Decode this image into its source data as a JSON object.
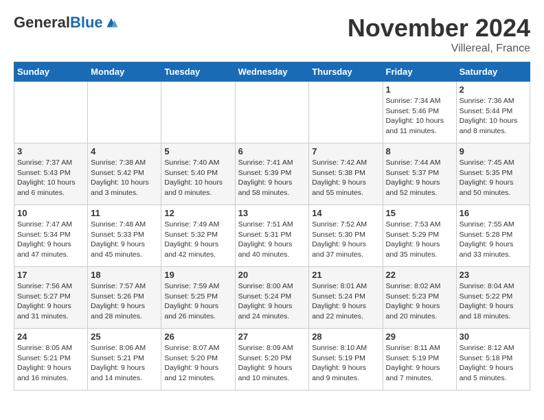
{
  "header": {
    "logo": {
      "general": "General",
      "blue": "Blue"
    },
    "title": "November 2024",
    "subtitle": "Villereal, France"
  },
  "days_of_week": [
    "Sunday",
    "Monday",
    "Tuesday",
    "Wednesday",
    "Thursday",
    "Friday",
    "Saturday"
  ],
  "weeks": [
    [
      {
        "day": null,
        "info": null
      },
      {
        "day": null,
        "info": null
      },
      {
        "day": null,
        "info": null
      },
      {
        "day": null,
        "info": null
      },
      {
        "day": null,
        "info": null
      },
      {
        "day": "1",
        "info": "Sunrise: 7:34 AM\nSunset: 5:46 PM\nDaylight: 10 hours and 11 minutes."
      },
      {
        "day": "2",
        "info": "Sunrise: 7:36 AM\nSunset: 5:44 PM\nDaylight: 10 hours and 8 minutes."
      }
    ],
    [
      {
        "day": "3",
        "info": "Sunrise: 7:37 AM\nSunset: 5:43 PM\nDaylight: 10 hours and 6 minutes."
      },
      {
        "day": "4",
        "info": "Sunrise: 7:38 AM\nSunset: 5:42 PM\nDaylight: 10 hours and 3 minutes."
      },
      {
        "day": "5",
        "info": "Sunrise: 7:40 AM\nSunset: 5:40 PM\nDaylight: 10 hours and 0 minutes."
      },
      {
        "day": "6",
        "info": "Sunrise: 7:41 AM\nSunset: 5:39 PM\nDaylight: 9 hours and 58 minutes."
      },
      {
        "day": "7",
        "info": "Sunrise: 7:42 AM\nSunset: 5:38 PM\nDaylight: 9 hours and 55 minutes."
      },
      {
        "day": "8",
        "info": "Sunrise: 7:44 AM\nSunset: 5:37 PM\nDaylight: 9 hours and 52 minutes."
      },
      {
        "day": "9",
        "info": "Sunrise: 7:45 AM\nSunset: 5:35 PM\nDaylight: 9 hours and 50 minutes."
      }
    ],
    [
      {
        "day": "10",
        "info": "Sunrise: 7:47 AM\nSunset: 5:34 PM\nDaylight: 9 hours and 47 minutes."
      },
      {
        "day": "11",
        "info": "Sunrise: 7:48 AM\nSunset: 5:33 PM\nDaylight: 9 hours and 45 minutes."
      },
      {
        "day": "12",
        "info": "Sunrise: 7:49 AM\nSunset: 5:32 PM\nDaylight: 9 hours and 42 minutes."
      },
      {
        "day": "13",
        "info": "Sunrise: 7:51 AM\nSunset: 5:31 PM\nDaylight: 9 hours and 40 minutes."
      },
      {
        "day": "14",
        "info": "Sunrise: 7:52 AM\nSunset: 5:30 PM\nDaylight: 9 hours and 37 minutes."
      },
      {
        "day": "15",
        "info": "Sunrise: 7:53 AM\nSunset: 5:29 PM\nDaylight: 9 hours and 35 minutes."
      },
      {
        "day": "16",
        "info": "Sunrise: 7:55 AM\nSunset: 5:28 PM\nDaylight: 9 hours and 33 minutes."
      }
    ],
    [
      {
        "day": "17",
        "info": "Sunrise: 7:56 AM\nSunset: 5:27 PM\nDaylight: 9 hours and 31 minutes."
      },
      {
        "day": "18",
        "info": "Sunrise: 7:57 AM\nSunset: 5:26 PM\nDaylight: 9 hours and 28 minutes."
      },
      {
        "day": "19",
        "info": "Sunrise: 7:59 AM\nSunset: 5:25 PM\nDaylight: 9 hours and 26 minutes."
      },
      {
        "day": "20",
        "info": "Sunrise: 8:00 AM\nSunset: 5:24 PM\nDaylight: 9 hours and 24 minutes."
      },
      {
        "day": "21",
        "info": "Sunrise: 8:01 AM\nSunset: 5:24 PM\nDaylight: 9 hours and 22 minutes."
      },
      {
        "day": "22",
        "info": "Sunrise: 8:02 AM\nSunset: 5:23 PM\nDaylight: 9 hours and 20 minutes."
      },
      {
        "day": "23",
        "info": "Sunrise: 8:04 AM\nSunset: 5:22 PM\nDaylight: 9 hours and 18 minutes."
      }
    ],
    [
      {
        "day": "24",
        "info": "Sunrise: 8:05 AM\nSunset: 5:21 PM\nDaylight: 9 hours and 16 minutes."
      },
      {
        "day": "25",
        "info": "Sunrise: 8:06 AM\nSunset: 5:21 PM\nDaylight: 9 hours and 14 minutes."
      },
      {
        "day": "26",
        "info": "Sunrise: 8:07 AM\nSunset: 5:20 PM\nDaylight: 9 hours and 12 minutes."
      },
      {
        "day": "27",
        "info": "Sunrise: 8:09 AM\nSunset: 5:20 PM\nDaylight: 9 hours and 10 minutes."
      },
      {
        "day": "28",
        "info": "Sunrise: 8:10 AM\nSunset: 5:19 PM\nDaylight: 9 hours and 9 minutes."
      },
      {
        "day": "29",
        "info": "Sunrise: 8:11 AM\nSunset: 5:19 PM\nDaylight: 9 hours and 7 minutes."
      },
      {
        "day": "30",
        "info": "Sunrise: 8:12 AM\nSunset: 5:18 PM\nDaylight: 9 hours and 5 minutes."
      }
    ]
  ]
}
